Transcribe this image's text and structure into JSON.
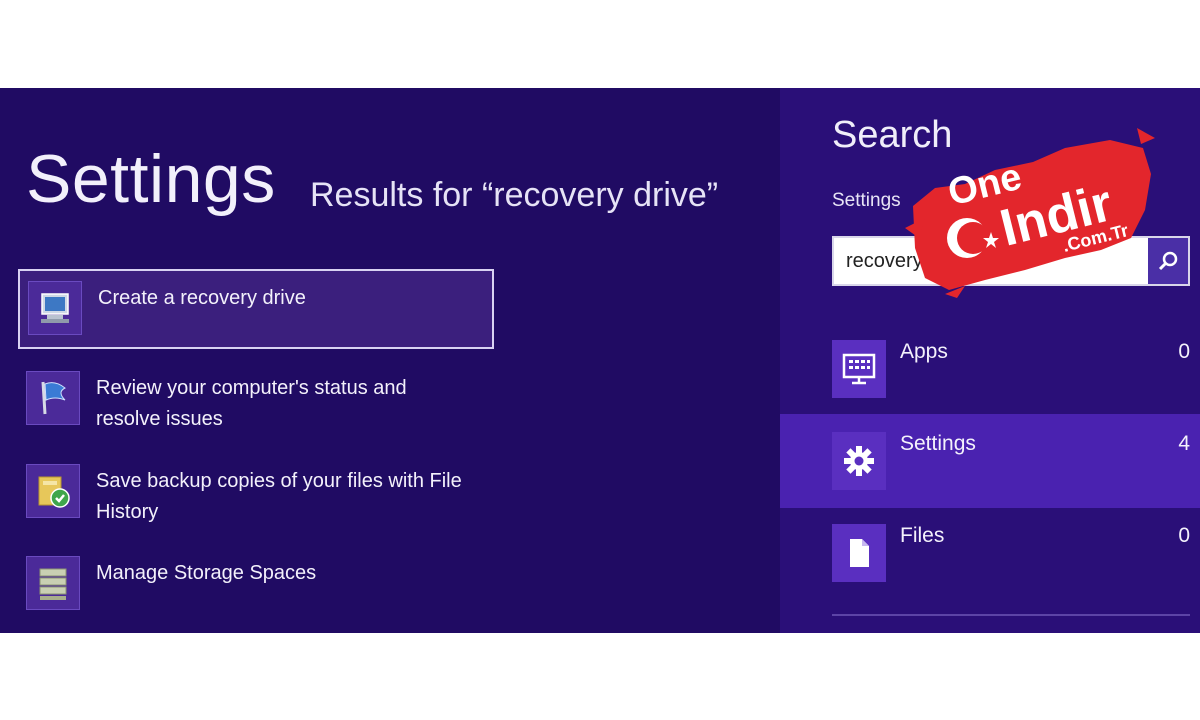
{
  "left": {
    "title": "Settings",
    "results_heading": "Results for “recovery drive”",
    "results": [
      {
        "label": "Create a recovery drive",
        "icon": "recovery-drive-icon"
      },
      {
        "label": "Review your computer's status and resolve issues",
        "icon": "action-center-flag-icon"
      },
      {
        "label": "Save backup copies of your files with File History",
        "icon": "file-history-icon"
      },
      {
        "label": "Manage Storage Spaces",
        "icon": "storage-spaces-icon"
      }
    ]
  },
  "search_pane": {
    "title": "Search",
    "scope": "Settings",
    "query": "recovery drive",
    "categories": [
      {
        "name": "Apps",
        "count": "0",
        "icon": "apps-icon"
      },
      {
        "name": "Settings",
        "count": "4",
        "icon": "gear-icon"
      },
      {
        "name": "Files",
        "count": "0",
        "icon": "file-icon"
      }
    ]
  },
  "watermark": {
    "line1": "One",
    "line2": "Indir",
    "line3": ".Com.Tr"
  },
  "colors": {
    "background": "#200b63",
    "charm_panel": "#2a0f78",
    "active_category": "#4a22b0",
    "watermark_red": "#e3262c"
  }
}
